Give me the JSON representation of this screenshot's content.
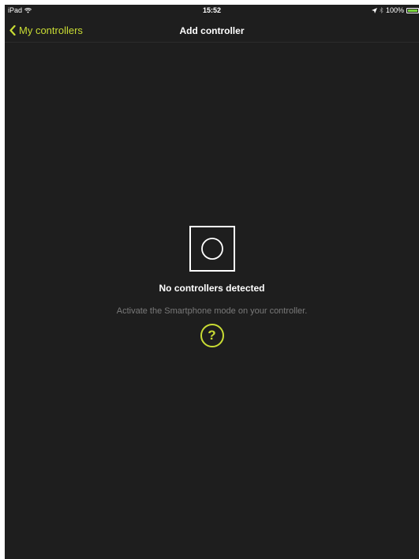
{
  "status_bar": {
    "device": "iPad",
    "time": "15:52",
    "battery": "100%",
    "battery_level": 1.0,
    "icons": [
      "wifi-icon",
      "location-arrow-icon",
      "bluetooth-icon",
      "battery-icon"
    ]
  },
  "nav": {
    "back_label": "My controllers",
    "back_icon": "chevron-left-icon",
    "title": "Add controller"
  },
  "empty_state": {
    "icon": "controller-circle-icon",
    "title": "No controllers detected",
    "subtitle": "Activate the Smartphone mode on your controller.",
    "help_label": "?"
  },
  "colors": {
    "accent": "#c9dc34",
    "background": "#1e1e1e",
    "text_primary": "#ffffff",
    "text_secondary": "#7a7a7a"
  }
}
